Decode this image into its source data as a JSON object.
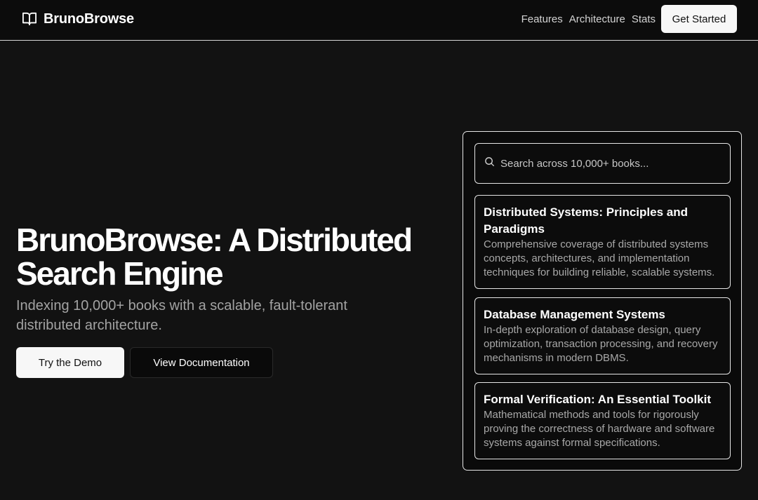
{
  "header": {
    "brand": "BrunoBrowse",
    "brand_icon": "open-book-icon",
    "nav": [
      "Features",
      "Architecture",
      "Stats"
    ],
    "cta": "Get Started"
  },
  "hero": {
    "title_line1": "BrunoBrowse: A Distributed",
    "title_line2": "Search Engine",
    "subtitle": "Indexing 10,000+ books with a scalable, fault-tolerant distributed architecture.",
    "primary_button": "Try the Demo",
    "secondary_button": "View Documentation"
  },
  "search": {
    "icon": "search-icon",
    "placeholder": "Search across 10,000+ books..."
  },
  "results": [
    {
      "title": "Distributed Systems: Principles and Paradigms",
      "description": "Comprehensive coverage of distributed systems concepts, architectures, and implementation techniques for building reliable, scalable systems."
    },
    {
      "title": "Database Management Systems",
      "description": "In-depth exploration of database design, query optimization, transaction processing, and recovery mechanisms in modern DBMS."
    },
    {
      "title": "Formal Verification: An Essential Toolkit",
      "description": "Mathematical methods and tools for rigorously proving the correctness of hardware and software systems against formal specifications."
    }
  ],
  "colors": {
    "background": "#121212",
    "header_background": "#0c0c0c",
    "panel_background": "#0a0a0a",
    "border": "#e5e5e5",
    "primary_button": "#f7f7f7",
    "muted_text": "#a3a3a3"
  }
}
